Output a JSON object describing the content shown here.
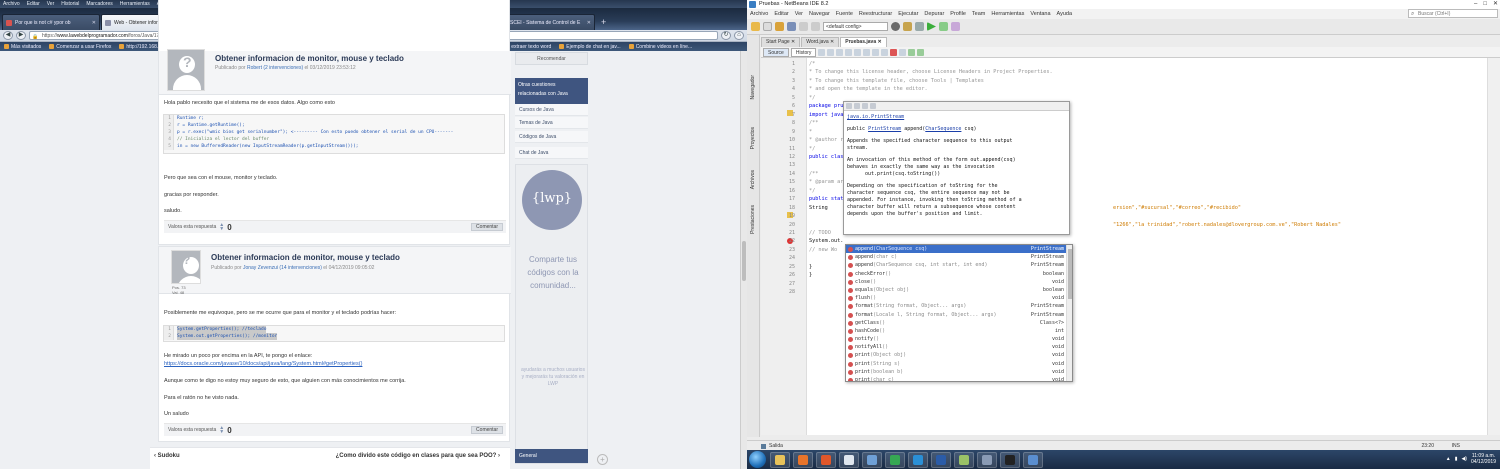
{
  "firefox": {
    "menu": [
      "Archivo",
      "Editar",
      "Ver",
      "Historial",
      "Marcadores",
      "Herramientas",
      "Ayuda"
    ],
    "tabs": [
      {
        "label": "Por que is not c# ypor ob",
        "color": "#d9534f",
        "active": false
      },
      {
        "label": "Web - Obtener informacion d",
        "color": "#8a8fa8",
        "active": true
      },
      {
        "label": "System (Java SE 10 & JDK 10 )",
        "color": "#e03b3b",
        "active": false
      },
      {
        "label": "traductor - Buscar con Google",
        "color": "#4a8af4",
        "active": false
      },
      {
        "label": "SCEI - Sistema de Control de E",
        "color": "#2d9a5a",
        "active": false
      },
      {
        "label": "SCEI - Sistema de Control de E",
        "color": "#2d9a5a",
        "active": false
      }
    ],
    "url_prefix": "https://",
    "url_host": "www.lawebdelprogramador.com",
    "url_path": "/foros/Java/1720812/Obtener-informacion-de-monitor-mouse-y-teclado.html",
    "bookmarks": [
      "Más visitados",
      "Comenzar a usar Firefox",
      "http://192.168.22.20:80...",
      "OpenLibra | Java Noti...",
      "A Neural Network Play...",
      "que es una ISP eninfor...",
      "Todo Java: Ejemplo de...",
      "crear word",
      "extraer texto word",
      "Ejemplo de chat en jav...",
      "Combine videos en líne..."
    ]
  },
  "post1": {
    "title": "Obtener informacion de monitor, mouse y teclado",
    "meta_prefix": "Publicado por",
    "author": "Robert (2 intervenciones)",
    "meta_suffix": "el 03/12/2019 23:53:12",
    "text1": "Hola pablo necesito que el sistema me de esos datos. Algo como esto",
    "code": [
      {
        "n": "1",
        "text": "Runtime r;"
      },
      {
        "n": "2",
        "text": "r = Runtime.getRuntime();"
      },
      {
        "n": "3",
        "text": "p = r.exec(\"wmic bios get serialnumber\");   <--------- Con esto puedo obtener el serial de un CPU-------"
      },
      {
        "n": "4",
        "text": "// Inicializa el lector del buffer"
      },
      {
        "n": "5",
        "text": "in = new BufferedReader(new InputStreamReader(p.getInputStream()));"
      }
    ],
    "text2": "Pero que sea con el mouse, monitor y teclado.",
    "text3": "gracias por responder.",
    "text4": "saludo.",
    "vote_label": "Valora esta respuesta",
    "votes": "0",
    "comment_btn": "Comentar"
  },
  "post2": {
    "title": "Obtener informacion de monitor, mouse y teclado",
    "meta_prefix": "Publicado por",
    "author": "Jonay Zevenzui (14 intervenciones)",
    "meta_suffix": "el 04/12/2019 09:05:02",
    "stats_pos": "Pos. 73",
    "stats_val": "Val. 48",
    "text1": "Posiblemente me equivoque, pero se me ocurre que para el monitor y el teclado podrías hacer:",
    "code": [
      {
        "n": "1",
        "text": "System.getProperties(); //teclado"
      },
      {
        "n": "2",
        "text": "System.out.getProperties(); //monitor"
      }
    ],
    "text2": "He mirado un poco por encima en la API, te pongo el enlace:",
    "link": "https://docs.oracle.com/javase/10/docs/api/java/lang/System.html#getProperties()",
    "text3": "Aunque como te digo no estoy muy seguro de esto, que alguien con más conocimientos me corrija.",
    "text4": "Para el ratón no he visto nada.",
    "text5": "Un saludo",
    "vote_label": "Valora esta respuesta",
    "votes": "0",
    "comment_btn": "Comentar"
  },
  "sidenav": {
    "recommend": "Recomendar",
    "other_q": "Otras cuestiones relacionadas con Java",
    "items": [
      "Cursos de Java",
      "Temas de Java",
      "Códigos de Java",
      "Chat de Java"
    ],
    "logo": "{lwp}",
    "promo_big": "Comparte tus códigos con la comunidad...",
    "promo_small": "ayudarás a muchos usuarios y mejorarás tu valoración en LWP",
    "general": "General"
  },
  "footnav": {
    "prev": "Sudoku",
    "next": "¿Como divido este código en clases para que sea POO?"
  },
  "netbeans": {
    "title": "Pruebas - NetBeans IDE 8.2",
    "menu": [
      "Archivo",
      "Editar",
      "Ver",
      "Navegar",
      "Fuente",
      "Reestructurar",
      "Ejecutar",
      "Depurar",
      "Profile",
      "Team",
      "Herramientas",
      "Ventana",
      "Ayuda"
    ],
    "search_placeholder": "Buscar (Ctrl+I)",
    "config": "<default config>",
    "side_tabs": [
      "Navegador",
      "Proyectos",
      "Archivos",
      "Prestaciones"
    ],
    "editor_tabs": [
      {
        "label": "Start Page",
        "active": false
      },
      {
        "label": "Word.java",
        "active": false
      },
      {
        "label": "Pruebas.java",
        "active": true
      }
    ],
    "source_btn": "Source",
    "history_btn": "History",
    "code_lines": [
      {
        "n": "1",
        "t": "/*",
        "k": "cmt"
      },
      {
        "n": "2",
        "t": " * To change this license header, choose License Headers in Project Properties.",
        "k": "cmt"
      },
      {
        "n": "3",
        "t": " * To change this template file, choose Tools | Templates",
        "k": "cmt"
      },
      {
        "n": "4",
        "t": " * and open the template in the editor.",
        "k": "cmt"
      },
      {
        "n": "5",
        "t": " */",
        "k": "cmt"
      },
      {
        "n": "6",
        "t": "package pruebas;",
        "k": "kw"
      },
      {
        "n": "7",
        "t": "import java.util",
        "k": "kw"
      },
      {
        "n": "8",
        "t": "/**",
        "k": "cmt"
      },
      {
        "n": "9",
        "t": " *",
        "k": "cmt"
      },
      {
        "n": "10",
        "t": " * @author rober",
        "k": "cmt"
      },
      {
        "n": "11",
        "t": " */",
        "k": "cmt"
      },
      {
        "n": "12",
        "t": "public class Prue",
        "k": "kw"
      },
      {
        "n": "13",
        "t": "",
        "k": ""
      },
      {
        "n": "14",
        "t": "    /**",
        "k": "cmt"
      },
      {
        "n": "15",
        "t": "     * @param ar",
        "k": "cmt"
      },
      {
        "n": "16",
        "t": "     */",
        "k": "cmt"
      },
      {
        "n": "17",
        "t": "    public static",
        "k": "kw"
      },
      {
        "n": "18",
        "t": "        String",
        "k": ""
      },
      {
        "n": "19",
        "t": "",
        "k": ""
      },
      {
        "n": "20",
        "t": "",
        "k": ""
      },
      {
        "n": "21",
        "t": "        // TODO",
        "k": "cmt"
      },
      {
        "n": "22",
        "t": "        System.out.",
        "k": ""
      },
      {
        "n": "23",
        "t": "    // new Wo",
        "k": "cmt"
      },
      {
        "n": "24",
        "t": "",
        "k": ""
      },
      {
        "n": "25",
        "t": "    }",
        "k": ""
      },
      {
        "n": "26",
        "t": "}",
        "k": ""
      },
      {
        "n": "27",
        "t": "",
        "k": ""
      },
      {
        "n": "28",
        "t": "",
        "k": ""
      }
    ],
    "str_line18": "ersion\",\"#sucursal\",\"#correo\",\"#recibido\"",
    "str_line20": "\"1266\",\"la trinidad\",\"robert.nadales@dlovergroup.com.ve\",\"Robert Nadales\"",
    "doc": {
      "cls": "java.io.PrintStream",
      "sig_pre": "public",
      "sig_type": "PrintStream",
      "sig_mid": "append(",
      "sig_param": "CharSequence",
      "sig_end": " csq)",
      "p1a": "Appends the specified character sequence to this output",
      "p1b": "stream.",
      "p2a": "An invocation of this method of the form out.append(csq)",
      "p2b": "behaves in exactly the same way as the invocation",
      "p2c": "out.print(csq.toString())",
      "p3a": "Depending on the specification of toString for the",
      "p3b": "character sequence csq, the entire sequence may not be",
      "p3c": "appended. For instance, invoking then toString method of a",
      "p3d": "character buffer will return a subsequence whose content",
      "p3e": "depends upon the buffer's position and limit."
    },
    "completion": [
      {
        "m": "append",
        "p": "(CharSequence csq)",
        "r": "PrintStream",
        "sel": true
      },
      {
        "m": "append",
        "p": "(char c)",
        "r": "PrintStream",
        "sel": false
      },
      {
        "m": "append",
        "p": "(CharSequence csq, int start, int end)",
        "r": "PrintStream",
        "sel": false
      },
      {
        "m": "checkError",
        "p": "()",
        "r": "boolean",
        "sel": false
      },
      {
        "m": "close",
        "p": "()",
        "r": "void",
        "sel": false
      },
      {
        "m": "equals",
        "p": "(Object obj)",
        "r": "boolean",
        "sel": false
      },
      {
        "m": "flush",
        "p": "()",
        "r": "void",
        "sel": false
      },
      {
        "m": "format",
        "p": "(String format, Object... args)",
        "r": "PrintStream",
        "sel": false
      },
      {
        "m": "format",
        "p": "(Locale l, String format, Object... args)",
        "r": "PrintStream",
        "sel": false
      },
      {
        "m": "getClass",
        "p": "()",
        "r": "Class<?>",
        "sel": false
      },
      {
        "m": "hashCode",
        "p": "()",
        "r": "int",
        "sel": false
      },
      {
        "m": "notify",
        "p": "()",
        "r": "void",
        "sel": false
      },
      {
        "m": "notifyAll",
        "p": "()",
        "r": "void",
        "sel": false
      },
      {
        "m": "print",
        "p": "(Object obj)",
        "r": "void",
        "sel": false
      },
      {
        "m": "print",
        "p": "(String s)",
        "r": "void",
        "sel": false
      },
      {
        "m": "print",
        "p": "(boolean b)",
        "r": "void",
        "sel": false
      },
      {
        "m": "print",
        "p": "(char c)",
        "r": "void",
        "sel": false
      }
    ],
    "status_output": "Salida",
    "status_pos": "23:20",
    "status_ins": "INS"
  },
  "taskbar": {
    "apps": [
      {
        "name": "file-explorer",
        "color": "#e8c25a"
      },
      {
        "name": "media-player",
        "color": "#e8742a"
      },
      {
        "name": "firefox",
        "color": "#e0572a"
      },
      {
        "name": "tool",
        "color": "#dfe6ee"
      },
      {
        "name": "terminal",
        "color": "#6fa0d6"
      },
      {
        "name": "chrome",
        "color": "#36a853"
      },
      {
        "name": "skype",
        "color": "#2a8fd6"
      },
      {
        "name": "word",
        "color": "#2b5ca8"
      },
      {
        "name": "app",
        "color": "#9ac267"
      },
      {
        "name": "photos",
        "color": "#8a9bb5"
      },
      {
        "name": "cmd",
        "color": "#222222"
      },
      {
        "name": "netbeans",
        "color": "#5a8ed0"
      }
    ],
    "time": "11:09 a.m.",
    "date": "04/12/2019"
  }
}
